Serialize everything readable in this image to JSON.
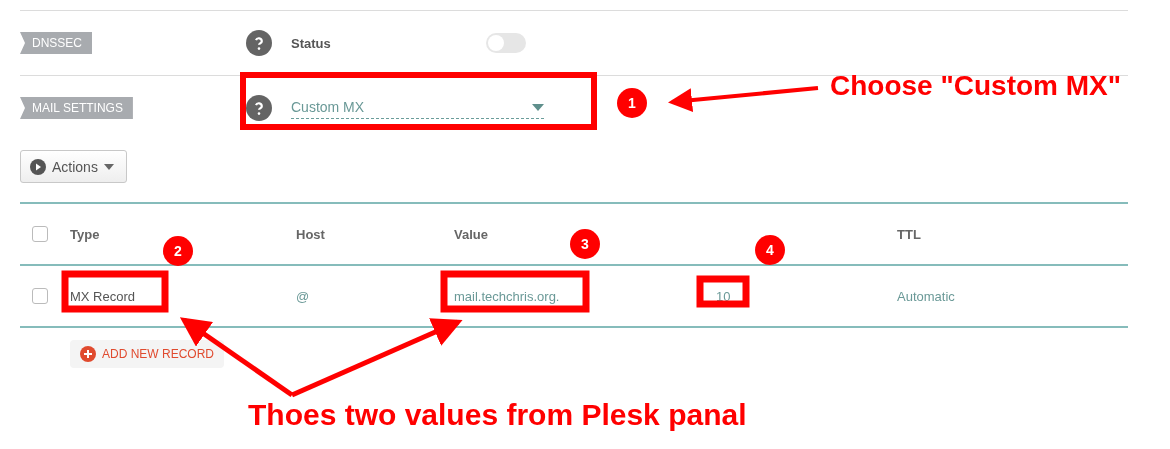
{
  "settings": [
    {
      "kind": "toggle",
      "label": "DNSSEC",
      "field_label": "Status",
      "on": false
    },
    {
      "kind": "select",
      "label": "MAIL SETTINGS",
      "value": "Custom MX"
    }
  ],
  "actions_button": "Actions",
  "table": {
    "header_checked": false,
    "columns": {
      "type": "Type",
      "host": "Host",
      "value": "Value",
      "ttl": "TTL"
    },
    "rows": [
      {
        "checked": false,
        "type": "MX Record",
        "host": "@",
        "value": "mail.techchris.org.",
        "column_5": "10",
        "ttl": "Automatic"
      }
    ]
  },
  "add_record_button": "ADD NEW RECORD",
  "annotations": {
    "markers": [
      "1",
      "2",
      "3",
      "4"
    ],
    "notes": [
      "Choose \"Custom MX\"",
      "Thoes two values from Plesk panal"
    ]
  }
}
